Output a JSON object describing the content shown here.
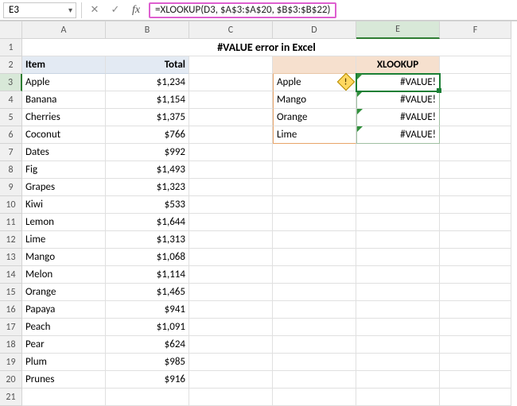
{
  "formula_bar": {
    "namebox_value": "E3",
    "formula": "=XLOOKUP(D3, $A$3:$A$20, $B$3:$B$22)"
  },
  "columns": [
    "A",
    "B",
    "C",
    "D",
    "E",
    "F"
  ],
  "rows": [
    "1",
    "2",
    "3",
    "4",
    "5",
    "6",
    "7",
    "8",
    "9",
    "10",
    "11",
    "12",
    "13",
    "14",
    "15",
    "16",
    "17",
    "18",
    "19",
    "20",
    "21"
  ],
  "title": "#VALUE error in Excel",
  "headers": {
    "item": "Item",
    "total": "Total",
    "xlookup": "XLOOKUP"
  },
  "items": [
    {
      "name": "Apple",
      "total": "$1,234"
    },
    {
      "name": "Banana",
      "total": "$1,154"
    },
    {
      "name": "Cherries",
      "total": "$1,375"
    },
    {
      "name": "Coconut",
      "total": "$766"
    },
    {
      "name": "Dates",
      "total": "$992"
    },
    {
      "name": "Fig",
      "total": "$1,493"
    },
    {
      "name": "Grapes",
      "total": "$1,323"
    },
    {
      "name": "Kiwi",
      "total": "$533"
    },
    {
      "name": "Lemon",
      "total": "$1,644"
    },
    {
      "name": "Lime",
      "total": "$1,313"
    },
    {
      "name": "Mango",
      "total": "$1,068"
    },
    {
      "name": "Melon",
      "total": "$1,114"
    },
    {
      "name": "Orange",
      "total": "$1,465"
    },
    {
      "name": "Papaya",
      "total": "$941"
    },
    {
      "name": "Peach",
      "total": "$1,091"
    },
    {
      "name": "Pear",
      "total": "$624"
    },
    {
      "name": "Plum",
      "total": "$985"
    },
    {
      "name": "Prunes",
      "total": "$916"
    }
  ],
  "lookup": [
    {
      "key": "Apple",
      "result": "#VALUE!"
    },
    {
      "key": "Mango",
      "result": "#VALUE!"
    },
    {
      "key": "Orange",
      "result": "#VALUE!"
    },
    {
      "key": "Lime",
      "result": "#VALUE!"
    }
  ],
  "icons": {
    "chevron": "▾",
    "cancel": "✕",
    "confirm": "✓",
    "warn": "!"
  }
}
